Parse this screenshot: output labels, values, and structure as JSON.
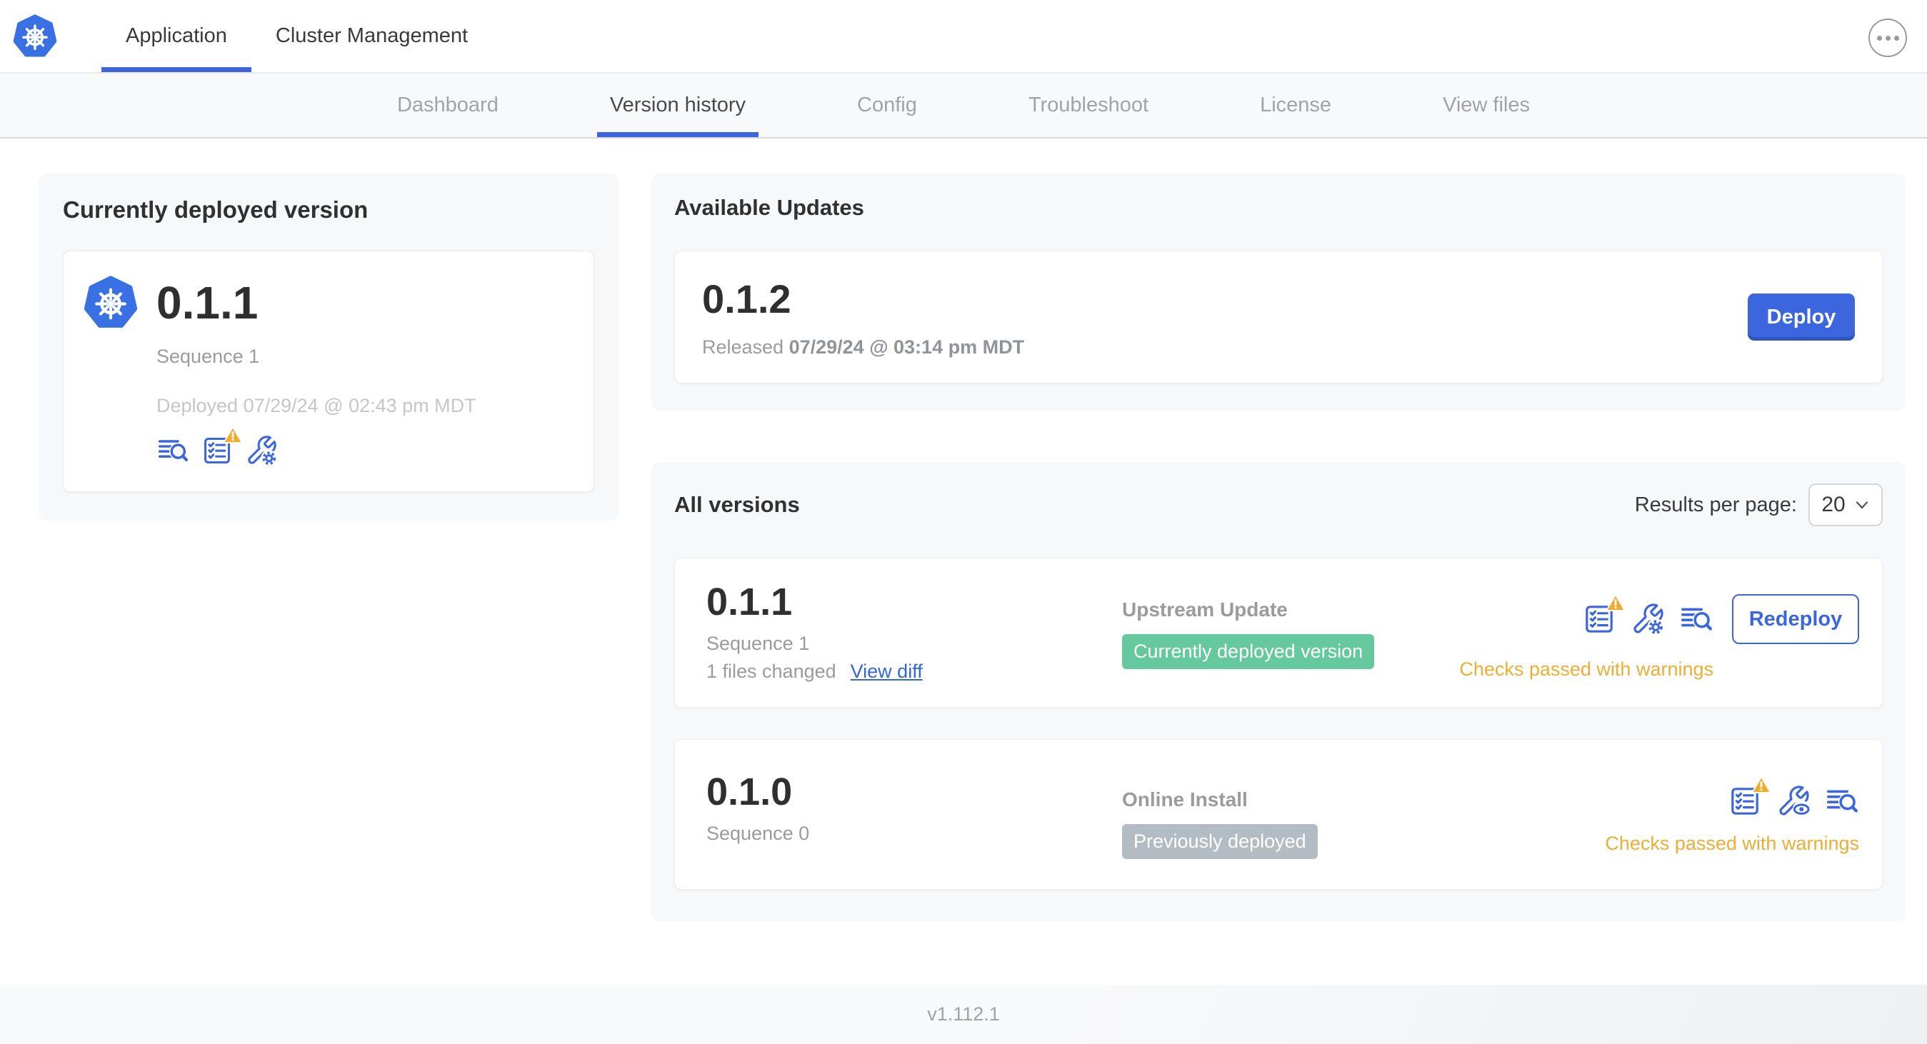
{
  "topnav": {
    "tabs": [
      {
        "label": "Application",
        "active": true
      },
      {
        "label": "Cluster Management",
        "active": false
      }
    ]
  },
  "subnav": {
    "tabs": [
      {
        "label": "Dashboard",
        "active": false
      },
      {
        "label": "Version history",
        "active": true
      },
      {
        "label": "Config",
        "active": false
      },
      {
        "label": "Troubleshoot",
        "active": false
      },
      {
        "label": "License",
        "active": false
      },
      {
        "label": "View files",
        "active": false
      }
    ]
  },
  "current_version_card": {
    "title": "Currently deployed version",
    "version": "0.1.1",
    "sequence": "Sequence 1",
    "deployed": "Deployed 07/29/24 @ 02:43 pm MDT",
    "icons": [
      "deploy-logs-icon",
      "preflight-checks-warning-icon",
      "edit-config-icon"
    ]
  },
  "available_updates": {
    "title": "Available Updates",
    "update": {
      "version": "0.1.2",
      "released_prefix": "Released",
      "released_date": "07/29/24 @ 03:14 pm MDT",
      "deploy_label": "Deploy"
    }
  },
  "all_versions": {
    "title": "All versions",
    "results_per_page_label": "Results per page:",
    "results_per_page_value": "20",
    "rows": [
      {
        "version": "0.1.1",
        "sequence": "Sequence 1",
        "files_changed": "1 files changed",
        "view_diff_label": "View diff",
        "source": "Upstream Update",
        "badge_label": "Currently deployed version",
        "badge_color": "#65c89f",
        "checks_status": "Checks passed with warnings",
        "action_label": "Redeploy",
        "icons": [
          "preflight-checks-warning-icon",
          "edit-config-icon",
          "deploy-logs-icon"
        ]
      },
      {
        "version": "0.1.0",
        "sequence": "Sequence 0",
        "source": "Online Install",
        "badge_label": "Previously deployed",
        "badge_color": "#b4bcc3",
        "checks_status": "Checks passed with warnings",
        "icons": [
          "preflight-checks-warning-icon",
          "view-config-icon",
          "deploy-logs-icon"
        ]
      }
    ]
  },
  "footer": {
    "app_version": "v1.112.1"
  },
  "colors": {
    "accent_blue": "#3b66de",
    "kubernetes_blue": "#3970e4",
    "link_blue": "#3366dd",
    "badge_green": "#65c89f",
    "badge_gray": "#b4bcc3",
    "warning_amber": "#ecae35",
    "card_background": "#f7f8fa"
  }
}
